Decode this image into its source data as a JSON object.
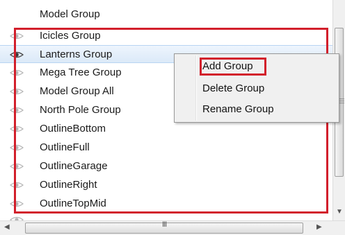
{
  "list": {
    "items": [
      {
        "label": "Model Group",
        "eye": false
      },
      {
        "label": "Icicles Group",
        "eye": true
      },
      {
        "label": "Lanterns Group",
        "eye": true,
        "selected": true
      },
      {
        "label": "Mega Tree Group",
        "eye": true
      },
      {
        "label": "Model Group All",
        "eye": true
      },
      {
        "label": "North Pole Group",
        "eye": true
      },
      {
        "label": "OutlineBottom",
        "eye": true
      },
      {
        "label": "OutlineFull",
        "eye": true
      },
      {
        "label": "OutlineGarage",
        "eye": true
      },
      {
        "label": "OutlineRight",
        "eye": true
      },
      {
        "label": "OutlineTopMid",
        "eye": true
      },
      {
        "label": "...",
        "eye": true
      }
    ]
  },
  "context_menu": {
    "add_group": "Add Group",
    "delete_group": "Delete Group",
    "rename_group": "Rename Group"
  },
  "scrollbar": {
    "grip": "III"
  },
  "colors": {
    "highlight_border": "#d21f2b",
    "selected_row": "#dbe9f8"
  }
}
